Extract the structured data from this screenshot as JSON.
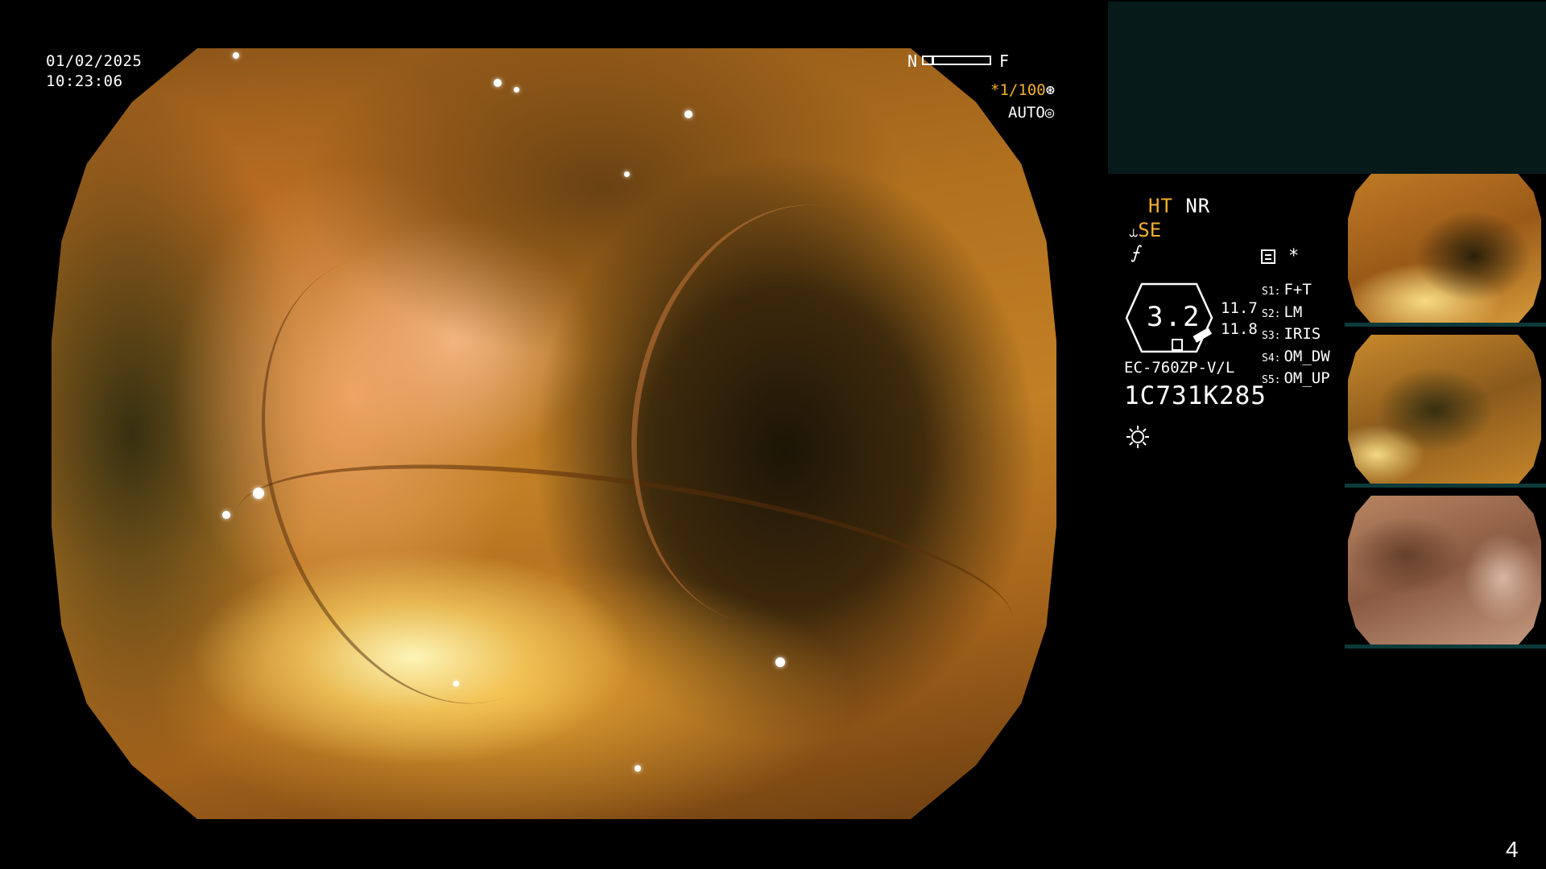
{
  "overlay": {
    "date": "01/02/2025",
    "time": "10:23:06"
  },
  "focus_scale": {
    "near_label": "N",
    "far_label": "F",
    "position_fraction": 0.12
  },
  "exposure": {
    "shutter": "*1/100",
    "iris": "AUTO"
  },
  "info_panel": {
    "ht_label": "HT",
    "nr_label": "NR",
    "se_label": "SE",
    "f_symbol": "⨍",
    "asterisk": "*",
    "zoom_value": "3.2",
    "zoom_side_top": "11.7",
    "zoom_side_bottom": "11.8",
    "scope_model": "EC-760ZP-V/L",
    "serial": "1C731K285"
  },
  "settings": [
    {
      "key": "S1:",
      "value": "F+T"
    },
    {
      "key": "S2:",
      "value": "LM"
    },
    {
      "key": "S3:",
      "value": "IRIS"
    },
    {
      "key": "S4:",
      "value": "OM_DW"
    },
    {
      "key": "S5:",
      "value": "OM_UP"
    }
  ],
  "colors": {
    "accent": "#f2b02c",
    "panel_bg": "#061a1a"
  },
  "icons": {
    "shutter": "aperture-icon",
    "iris": "iris-icon",
    "light": "light-source-icon",
    "list": "list-icon"
  },
  "page_number": "4"
}
